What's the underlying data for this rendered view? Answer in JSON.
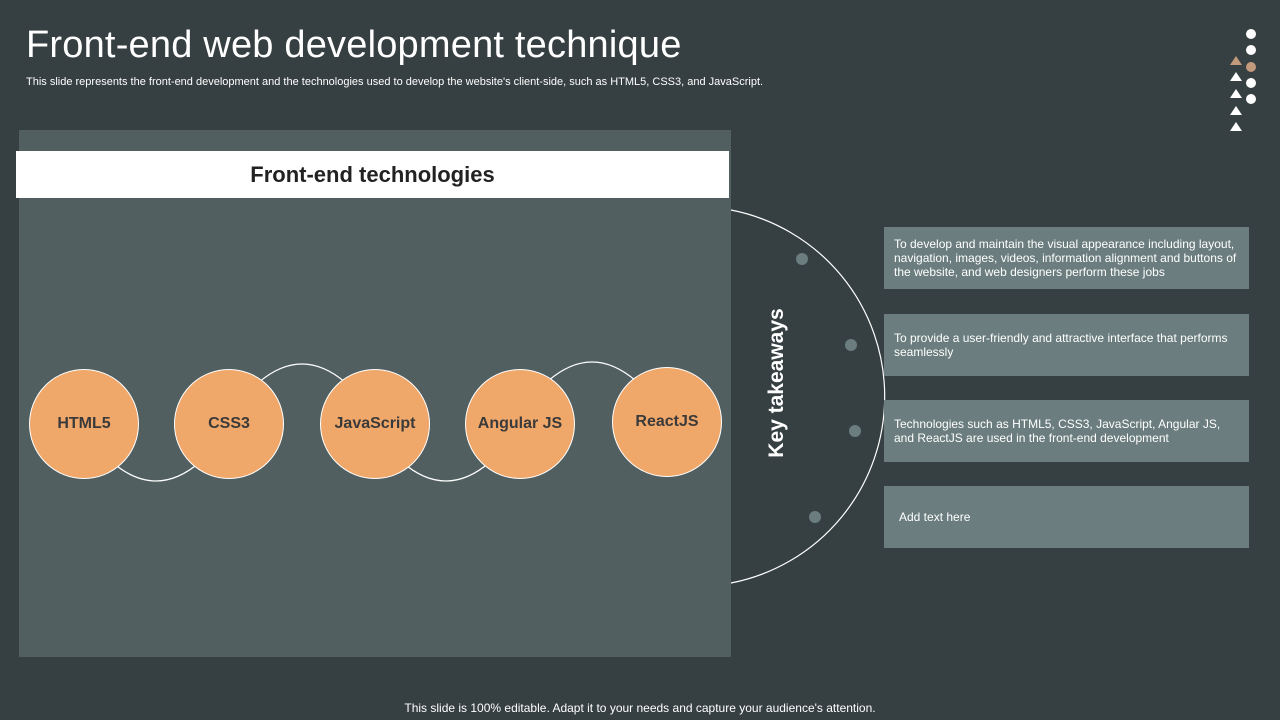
{
  "slide": {
    "title": "Front-end web development technique",
    "subtitle": "This slide represents the front-end development and the technologies used to develop the website's client-side, such as HTML5, CSS3, and JavaScript.",
    "footer": "This slide is 100% editable. Adapt it to your needs and capture your audience's attention."
  },
  "panel": {
    "header": "Front-end technologies",
    "technologies": [
      "HTML5",
      "CSS3",
      "JavaScript",
      "Angular JS",
      "ReactJS"
    ]
  },
  "takeaways": {
    "label": "Key takeaways",
    "items": [
      "To develop and maintain the visual appearance including layout, navigation, images, videos, information alignment and buttons of the website, and web designers perform these jobs",
      "To provide a user-friendly and attractive interface that performs seamlessly",
      "Technologies such as HTML5, CSS3, JavaScript, Angular JS, and ReactJS are used in the front-end development",
      "Add text here"
    ]
  },
  "colors": {
    "background": "#363F42",
    "panel": "#525F61",
    "circle": "#F0A76A",
    "takeaway_box": "#6B7D7E",
    "accent_tan": "#C49A7C"
  },
  "decoration": {
    "icon": "circles-and-triangles-decoration-icon"
  }
}
